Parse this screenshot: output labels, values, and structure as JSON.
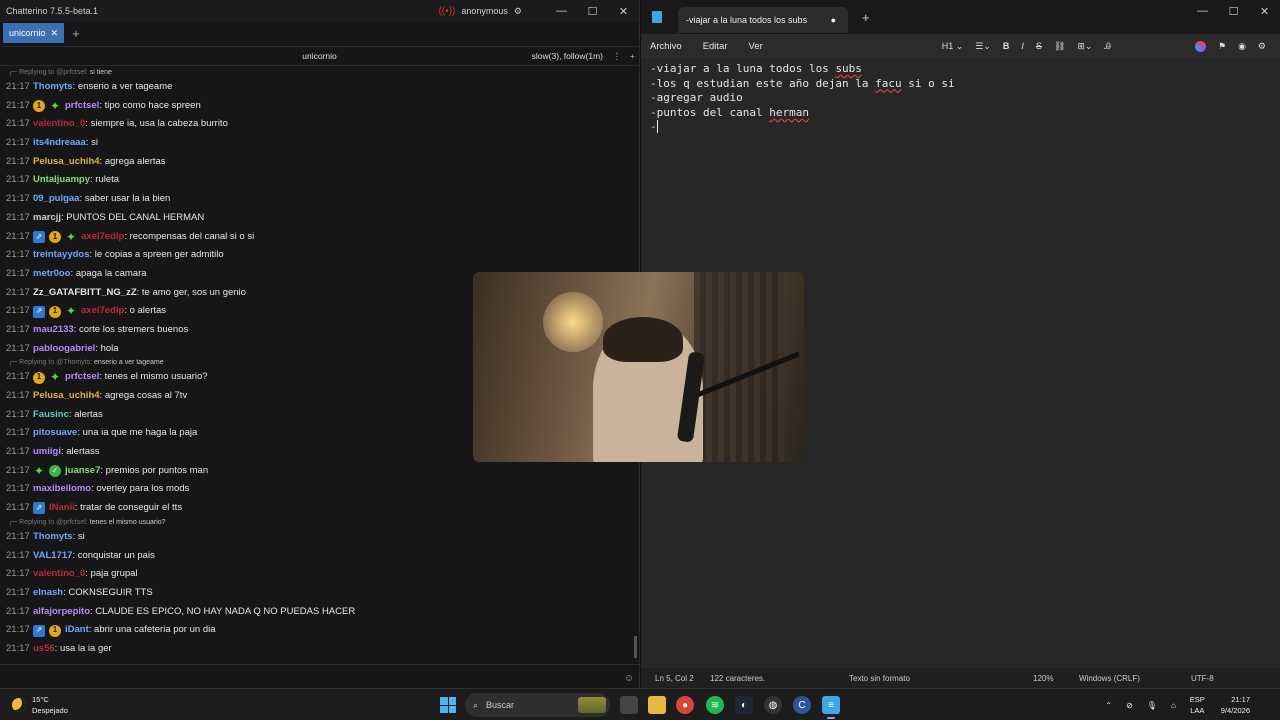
{
  "chatterino": {
    "title": "Chatterino 7.5.5-beta.1",
    "account": "anonymous",
    "tab_label": "unicornio",
    "channel": "unicornio",
    "modes": "slow(3), follow(1m)"
  },
  "messages": [
    {
      "reply_to": "@prfctsel:",
      "reply_text": "si tiene"
    },
    {
      "time": "21:17",
      "user": "Thomyts",
      "color": "#6ea8ff",
      "badges": [],
      "text": "enserio a ver tageame"
    },
    {
      "time": "21:17",
      "user": "prfctsel",
      "color": "#b48cff",
      "badges": [
        "sub",
        "gem"
      ],
      "text": "tipo como hace spreen"
    },
    {
      "time": "21:17",
      "user": "valentino_0",
      "color": "#c0283a",
      "badges": [],
      "text": "siempre ia, usa la cabeza burrito"
    },
    {
      "time": "21:17",
      "user": "its4ndreaaa",
      "color": "#6ea8ff",
      "badges": [],
      "text": "si"
    },
    {
      "time": "21:17",
      "user": "Pelusa_uchih4",
      "color": "#e2b23c",
      "badges": [],
      "text": "agrega alertas"
    },
    {
      "time": "21:17",
      "user": "Untaljuampy",
      "color": "#7fe07a",
      "badges": [],
      "text": "ruleta"
    },
    {
      "time": "21:17",
      "user": "09_pulgaa",
      "color": "#6ea8ff",
      "badges": [],
      "text": "saber usar la ia bien"
    },
    {
      "time": "21:17",
      "user": "marcjj",
      "color": "#cfcfcf",
      "badges": [],
      "text": "PUNTOS DEL CANAL HERMAN"
    },
    {
      "time": "21:17",
      "user": "axel7edlp",
      "color": "#c0283a",
      "badges": [
        "prime",
        "sub",
        "gem"
      ],
      "text": "recompensas del canal si o si"
    },
    {
      "time": "21:17",
      "user": "treintayydos",
      "color": "#6ea8ff",
      "badges": [],
      "text": "le copias a spreen ger admitilo"
    },
    {
      "time": "21:17",
      "user": "metr0oo",
      "color": "#6ea8ff",
      "badges": [],
      "text": "apaga la camara"
    },
    {
      "time": "21:17",
      "user": "Zz_GATAFBITT_NG_zZ",
      "color": "#e6e6e6",
      "badges": [],
      "text": "te amo ger, sos un genio"
    },
    {
      "time": "21:17",
      "user": "axel7edlp",
      "color": "#c0283a",
      "badges": [
        "prime",
        "sub",
        "gem"
      ],
      "text": "o alertas"
    },
    {
      "time": "21:17",
      "user": "mau2133",
      "color": "#b48cff",
      "badges": [],
      "text": "corte los stremers buenos"
    },
    {
      "time": "21:17",
      "user": "pabloogabriel",
      "color": "#b48cff",
      "badges": [],
      "text": "hola"
    },
    {
      "reply_to": "@Thomyts:",
      "reply_text": "enserio a ver tageame"
    },
    {
      "time": "21:17",
      "user": "prfctsel",
      "color": "#b48cff",
      "badges": [
        "sub",
        "gem"
      ],
      "text": "tenes el mismo usuario?"
    },
    {
      "time": "21:17",
      "user": "Pelusa_uchih4",
      "color": "#e2b23c",
      "badges": [],
      "text": "agrega cosas al 7tv"
    },
    {
      "time": "21:17",
      "user": "Fausinc",
      "color": "#4fd1c5",
      "badges": [],
      "text": "alertas"
    },
    {
      "time": "21:17",
      "user": "pitosuave",
      "color": "#6ea8ff",
      "badges": [],
      "text": "una ia que me haga la paja"
    },
    {
      "time": "21:17",
      "user": "umiigi",
      "color": "#b48cff",
      "badges": [],
      "text": "alertass"
    },
    {
      "time": "21:17",
      "user": "juanse7",
      "color": "#7fe07a",
      "badges": [
        "gem",
        "check"
      ],
      "text": "premios por puntos man"
    },
    {
      "time": "21:17",
      "user": "maxibellomo",
      "color": "#b48cff",
      "badges": [],
      "text": "overley para los mods"
    },
    {
      "time": "21:17",
      "user": "INanii",
      "color": "#c0283a",
      "badges": [
        "prime"
      ],
      "text": "tratar de conseguir el tts"
    },
    {
      "reply_to": "@prfctsel:",
      "reply_text": "tenes el mismo usuario?"
    },
    {
      "time": "21:17",
      "user": "Thomyts",
      "color": "#6ea8ff",
      "badges": [],
      "text": "si"
    },
    {
      "time": "21:17",
      "user": "VAL1717",
      "color": "#6ea8ff",
      "badges": [],
      "text": "conquistar un pais"
    },
    {
      "time": "21:17",
      "user": "valentino_0",
      "color": "#c0283a",
      "badges": [],
      "text": "paja grupal"
    },
    {
      "time": "21:17",
      "user": "elnash",
      "color": "#6ea8ff",
      "badges": [],
      "text": "COKNSEGUIR TTS"
    },
    {
      "time": "21:17",
      "user": "alfajorpepito",
      "color": "#b48cff",
      "badges": [],
      "text": "CLAUDE ES EPICO, NO HAY NADA Q NO PUEDAS HACER"
    },
    {
      "time": "21:17",
      "user": "iDant",
      "color": "#6ea8ff",
      "badges": [
        "prime",
        "sub"
      ],
      "text": "abrir una cafeteria por un dia"
    },
    {
      "time": "21:17",
      "user": "us56",
      "color": "#c0283a",
      "badges": [],
      "text": "usa la ia ger"
    }
  ],
  "reply_prefix": "Replying to",
  "notepad": {
    "tab_title": "-viajar a la luna todos los subs",
    "menus": [
      "Archivo",
      "Editar",
      "Ver"
    ],
    "heading_select": "H1",
    "lines": [
      "-viajar a la luna todos los subs",
      "-los q estudian este año dejan la facu si o si",
      "-agregar audio",
      "-puntos del canal herman",
      "-"
    ],
    "status": {
      "position": "Ln 5, Col 2",
      "chars": "122 caracteres.",
      "format": "Texto sin formato",
      "zoom": "120%",
      "eol": "Windows (CRLF)",
      "encoding": "UTF-8"
    }
  },
  "taskbar": {
    "temp": "15°C",
    "condition": "Despejado",
    "search": "Buscar",
    "lang1": "ESP",
    "lang2": "LAA",
    "time": "21:17",
    "date": "9/4/2026"
  }
}
